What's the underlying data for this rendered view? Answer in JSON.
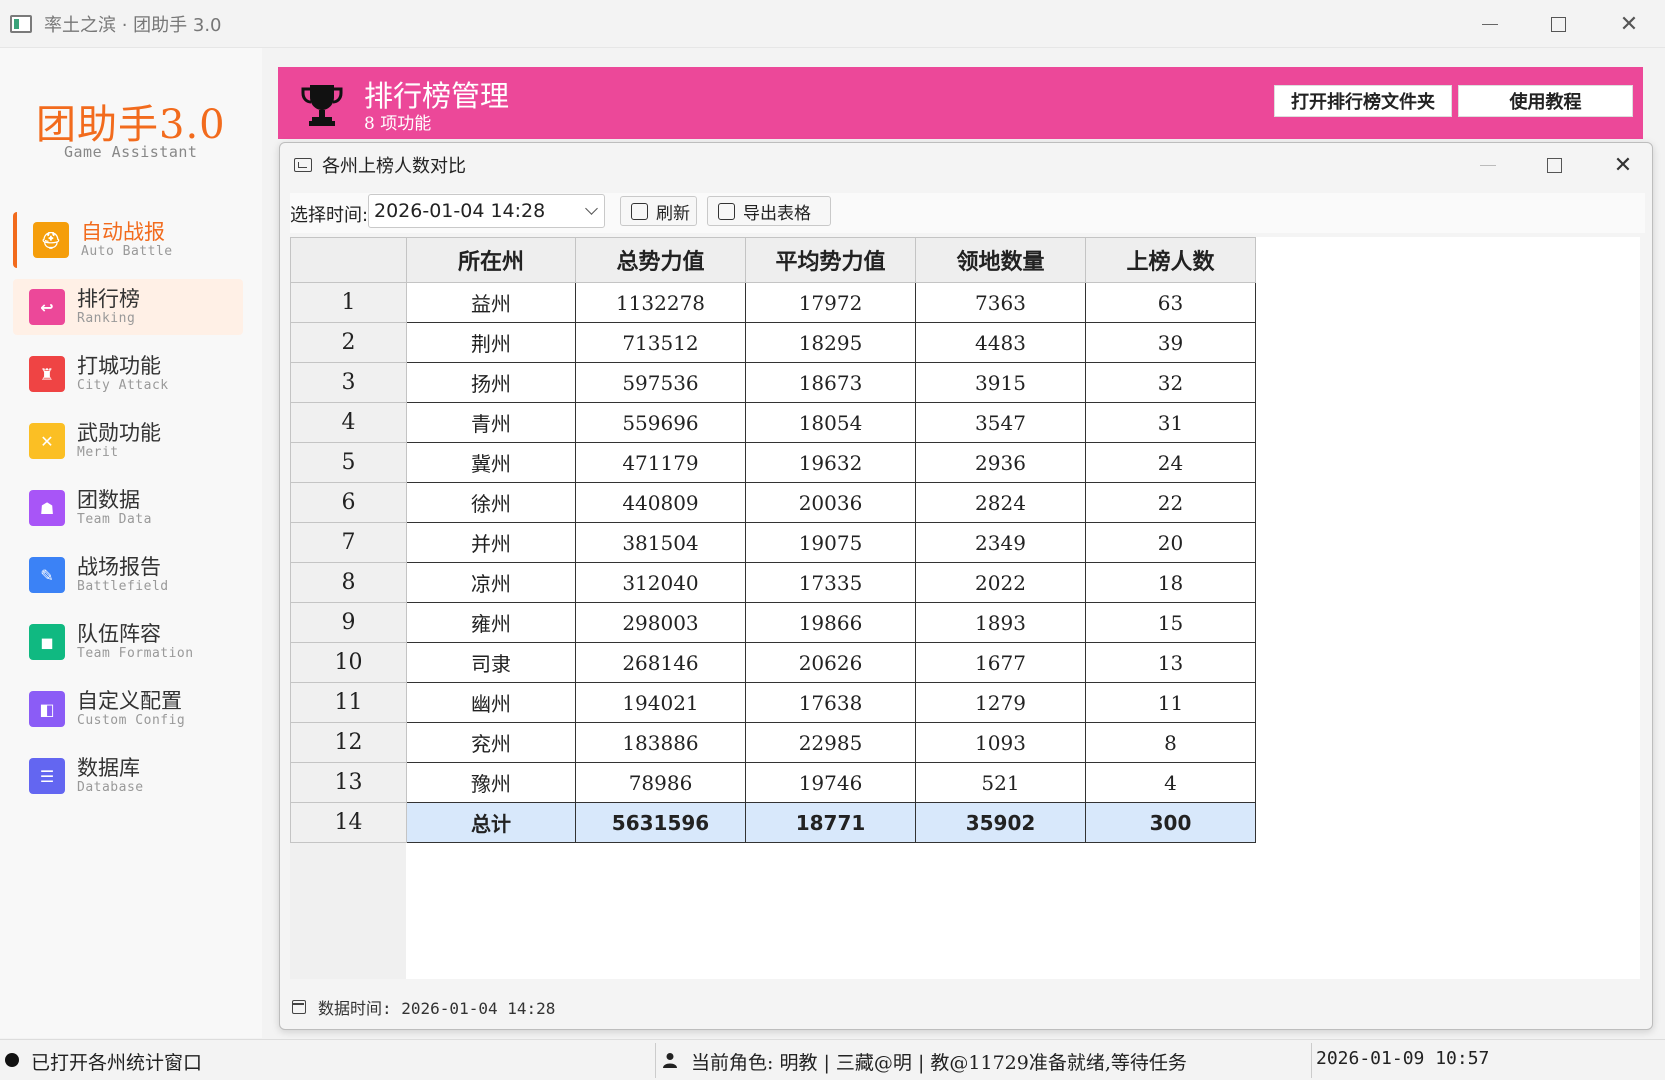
{
  "window": {
    "title": "率土之滨 · 团助手 3.0"
  },
  "brand": {
    "name": "团助手3.0",
    "subtitle": "Game Assistant"
  },
  "sidebar": {
    "items": [
      {
        "label": "自动战报",
        "sub": "Auto Battle",
        "icon": "helmet-icon",
        "color": "#f59e0b"
      },
      {
        "label": "排行榜",
        "sub": "Ranking",
        "icon": "ranking-icon",
        "color": "#ec4899"
      },
      {
        "label": "打城功能",
        "sub": "City Attack",
        "icon": "castle-icon",
        "color": "#ef4444"
      },
      {
        "label": "武勋功能",
        "sub": "Merit",
        "icon": "swords-icon",
        "color": "#fbbf24"
      },
      {
        "label": "团数据",
        "sub": "Team Data",
        "icon": "team-icon",
        "color": "#a855f7"
      },
      {
        "label": "战场报告",
        "sub": "Battlefield",
        "icon": "report-icon",
        "color": "#3b82f6"
      },
      {
        "label": "队伍阵容",
        "sub": "Team Formation",
        "icon": "formation-icon",
        "color": "#10b981"
      },
      {
        "label": "自定义配置",
        "sub": "Custom Config",
        "icon": "config-icon",
        "color": "#8b5cf6"
      },
      {
        "label": "数据库",
        "sub": "Database",
        "icon": "database-icon",
        "color": "#6366f1"
      }
    ]
  },
  "header": {
    "title": "排行榜管理",
    "subtitle": "8 项功能",
    "open_folder_label": "打开排行榜文件夹",
    "tutorial_label": "使用教程",
    "color": "#ec4899"
  },
  "dialog": {
    "title": "各州上榜人数对比",
    "time_label": "选择时间:",
    "time_value": "2026-01-04 14:28",
    "refresh_label": "刷新",
    "export_label": "导出表格",
    "data_time": "数据时间: 2026-01-04 14:28"
  },
  "table": {
    "columns": [
      "所在州",
      "总势力值",
      "平均势力值",
      "领地数量",
      "上榜人数"
    ],
    "rows": [
      {
        "num": "1",
        "cells": [
          "益州",
          "1132278",
          "17972",
          "7363",
          "63"
        ]
      },
      {
        "num": "2",
        "cells": [
          "荆州",
          "713512",
          "18295",
          "4483",
          "39"
        ]
      },
      {
        "num": "3",
        "cells": [
          "扬州",
          "597536",
          "18673",
          "3915",
          "32"
        ]
      },
      {
        "num": "4",
        "cells": [
          "青州",
          "559696",
          "18054",
          "3547",
          "31"
        ]
      },
      {
        "num": "5",
        "cells": [
          "冀州",
          "471179",
          "19632",
          "2936",
          "24"
        ]
      },
      {
        "num": "6",
        "cells": [
          "徐州",
          "440809",
          "20036",
          "2824",
          "22"
        ]
      },
      {
        "num": "7",
        "cells": [
          "并州",
          "381504",
          "19075",
          "2349",
          "20"
        ]
      },
      {
        "num": "8",
        "cells": [
          "凉州",
          "312040",
          "17335",
          "2022",
          "18"
        ]
      },
      {
        "num": "9",
        "cells": [
          "雍州",
          "298003",
          "19866",
          "1893",
          "15"
        ]
      },
      {
        "num": "10",
        "cells": [
          "司隶",
          "268146",
          "20626",
          "1677",
          "13"
        ]
      },
      {
        "num": "11",
        "cells": [
          "幽州",
          "194021",
          "17638",
          "1279",
          "11"
        ]
      },
      {
        "num": "12",
        "cells": [
          "兖州",
          "183886",
          "22985",
          "1093",
          "8"
        ]
      },
      {
        "num": "13",
        "cells": [
          "豫州",
          "78986",
          "19746",
          "521",
          "4"
        ]
      }
    ],
    "total": {
      "num": "14",
      "cells": [
        "总计",
        "5631596",
        "18771",
        "35902",
        "300"
      ]
    }
  },
  "status": {
    "left": "已打开各州统计窗口",
    "role": "当前角色: 明教 | 三藏@明 | 教@11729准备就绪,等待任务",
    "time": "2026-01-09 10:57"
  }
}
